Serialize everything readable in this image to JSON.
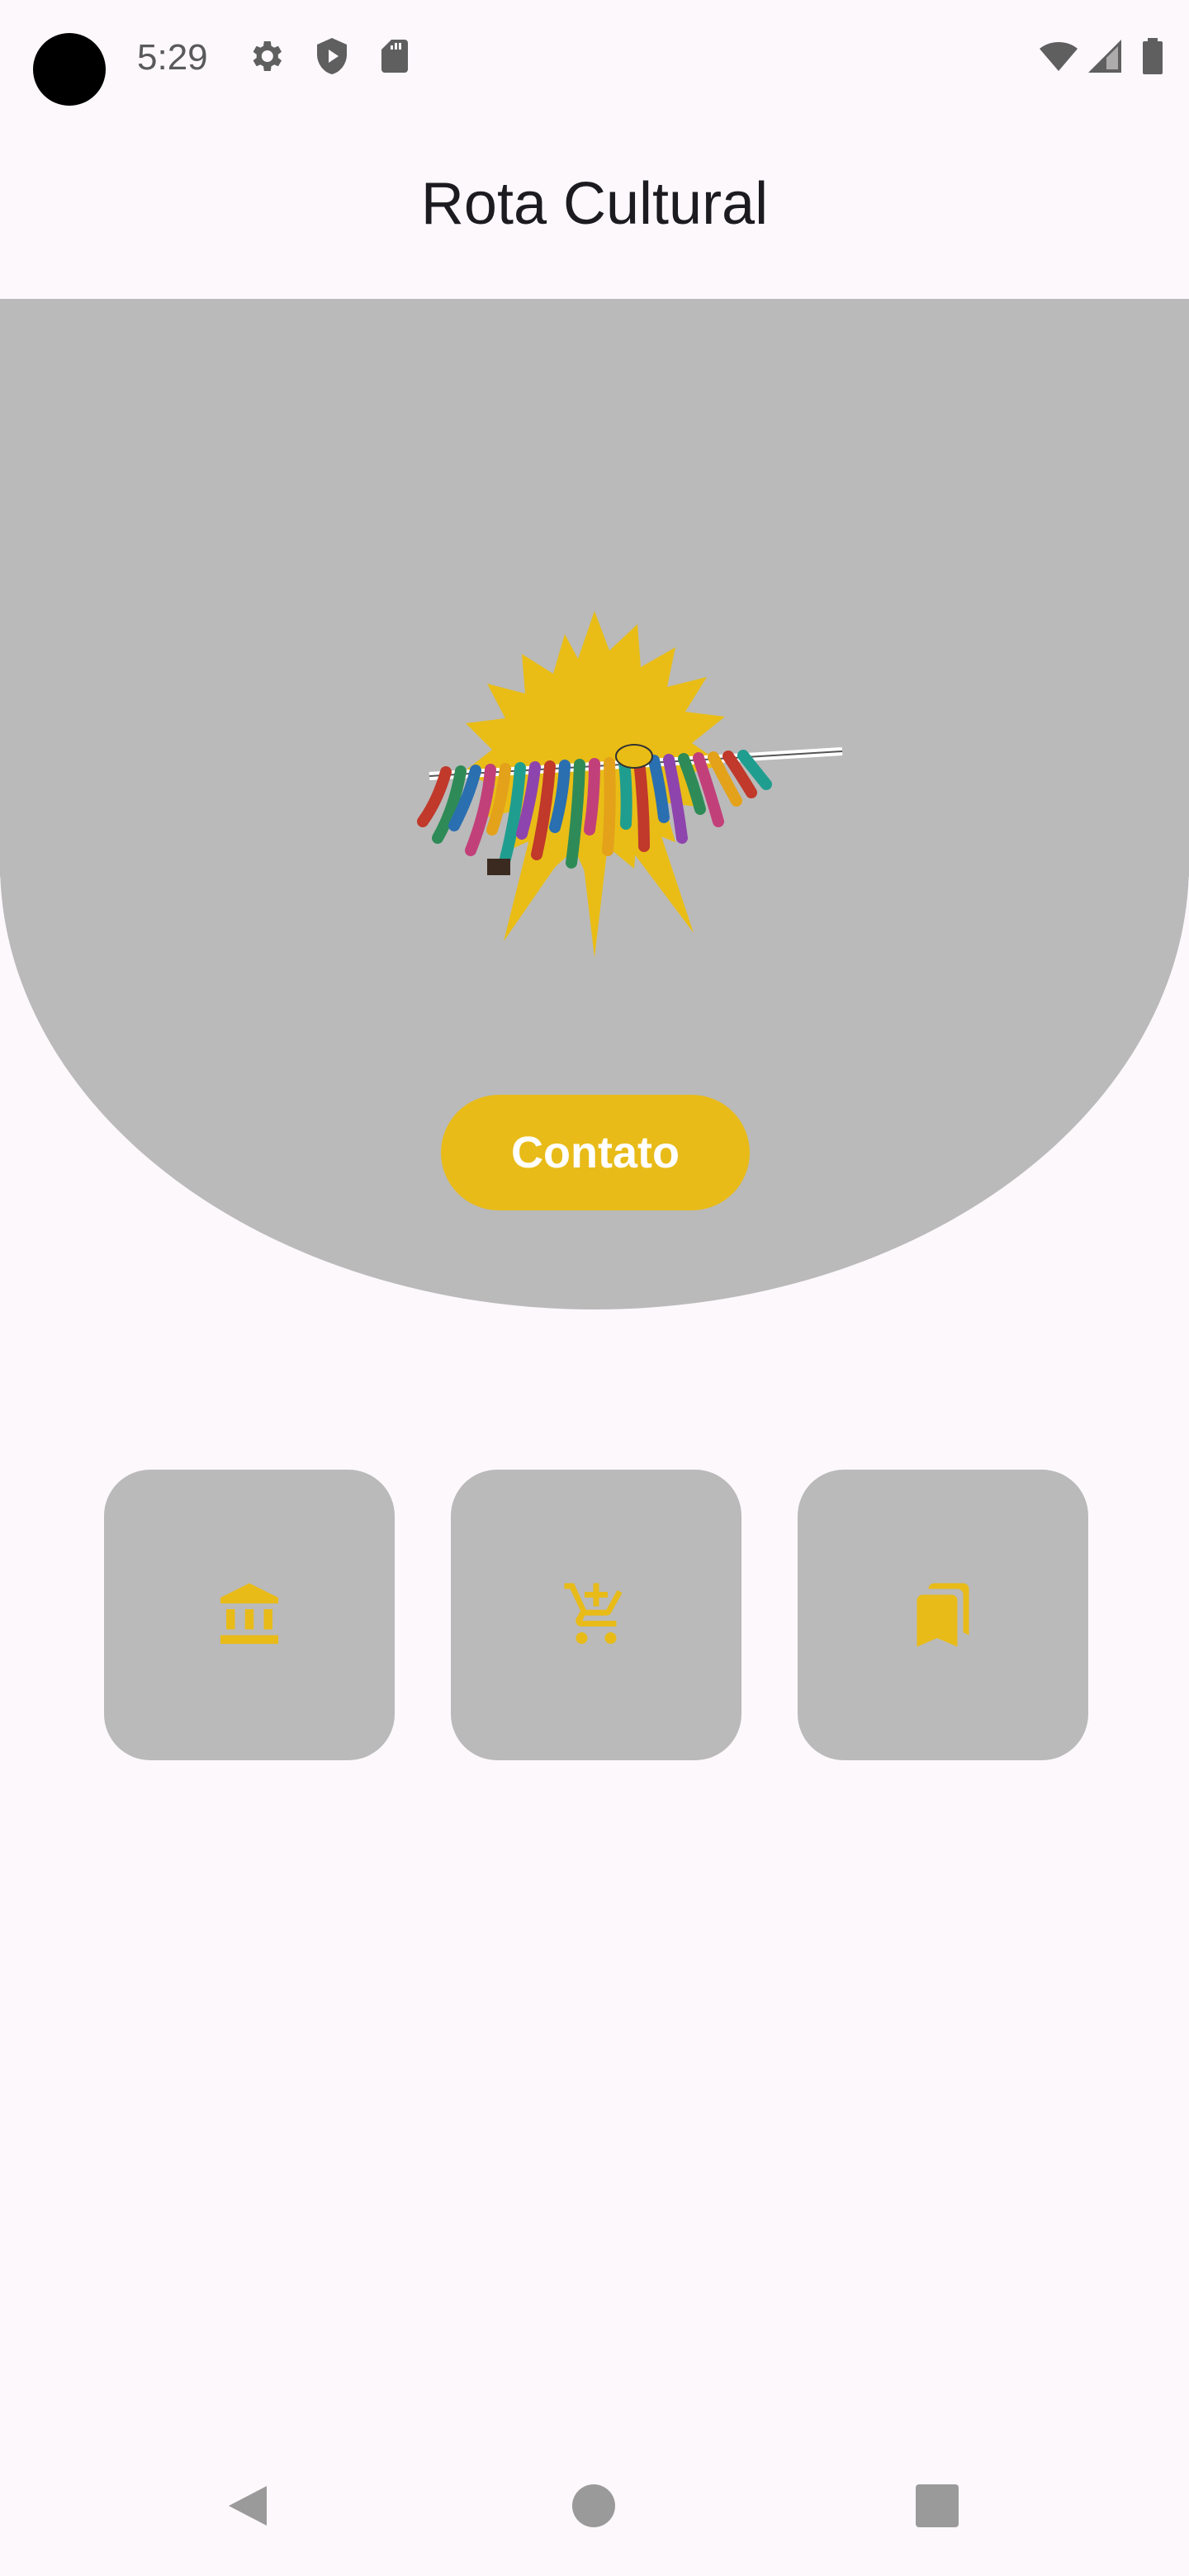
{
  "status_bar": {
    "time": "5:29",
    "icons": [
      "gear-icon",
      "shield-play-icon",
      "sd-card-icon",
      "wifi-icon",
      "signal-icon",
      "battery-icon"
    ]
  },
  "app_bar": {
    "title": "Rota Cultural"
  },
  "hero": {
    "logo": "sun-with-colorful-ribbons-logo",
    "contact_label": "Contato"
  },
  "tiles": [
    {
      "icon": "museum-icon"
    },
    {
      "icon": "add-shopping-cart-icon"
    },
    {
      "icon": "bookmarks-icon"
    }
  ],
  "nav_bar": {
    "buttons": [
      "back-icon",
      "home-icon",
      "recents-icon"
    ]
  },
  "colors": {
    "accent": "#e8bb18",
    "surface_gray": "#bababa",
    "background": "#fdf8fc"
  }
}
